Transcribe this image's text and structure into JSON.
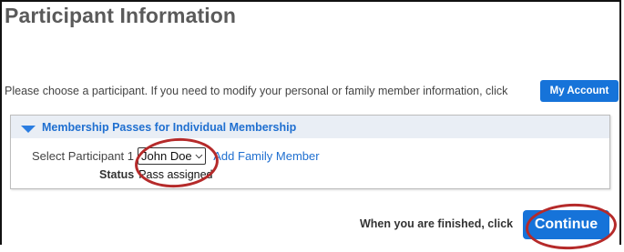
{
  "page": {
    "title": "Participant Information",
    "intro_text": "Please choose a participant. If you need to modify your personal or family member information, click",
    "my_account_label": "My Account"
  },
  "panel": {
    "title": "Membership Passes for Individual Membership",
    "select_label": "Select Participant 1",
    "selected_participant": "John Doe",
    "add_family_label": "Add Family Member",
    "status_label": "Status",
    "status_value": "Pass assigned"
  },
  "footer": {
    "finish_text": "When you are finished, click",
    "continue_label": "Continue"
  },
  "colors": {
    "accent": "#1673d9",
    "link": "#1f6fd0",
    "annotation": "#b52a2a",
    "panel_header_bg": "#e9eef5"
  },
  "icons": {
    "panel_toggle": "caret-down-icon",
    "select_chevron": "chevron-down-icon"
  }
}
